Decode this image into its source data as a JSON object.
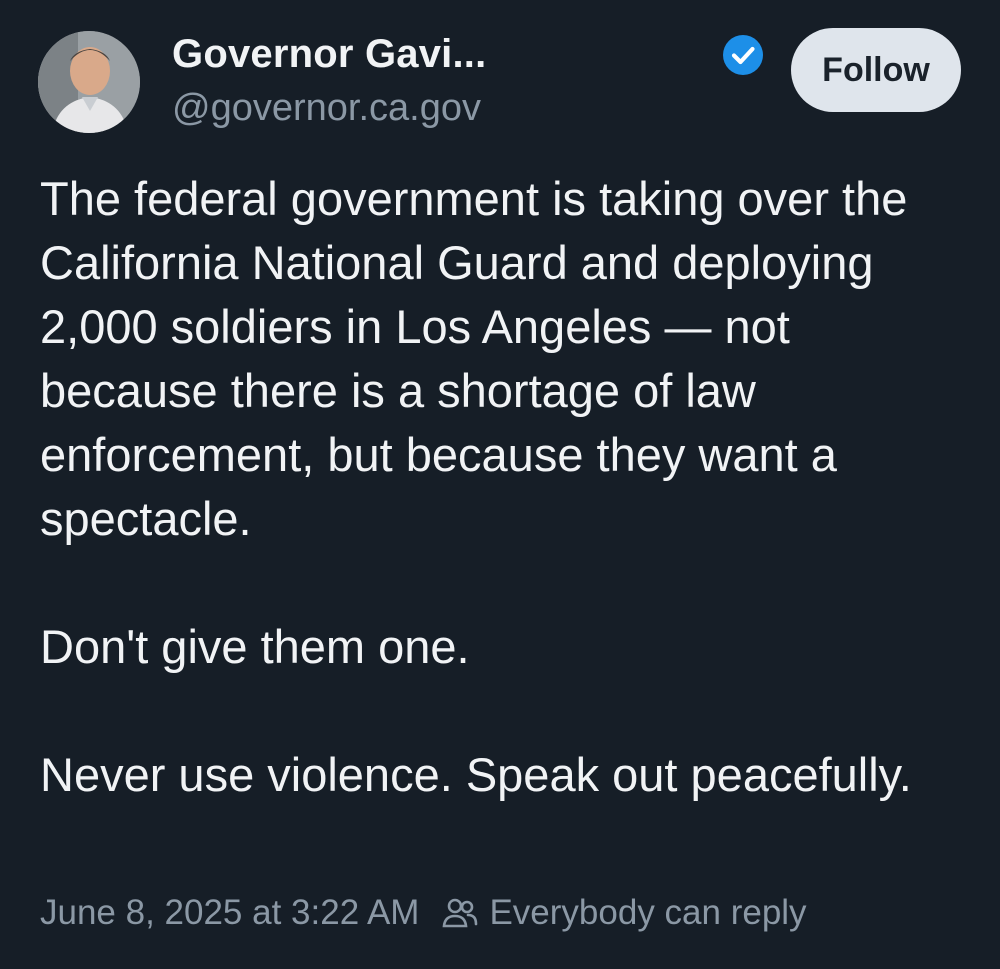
{
  "author": {
    "name": "Governor Gavi...",
    "handle": "@governor.ca.gov",
    "verified_icon": "verified-check-icon",
    "verified_color": "#1d8fe8"
  },
  "follow_button": {
    "label": "Follow"
  },
  "post": {
    "paragraphs": [
      "The federal government is taking over the California National Guard and deploying 2,000 soldiers in Los Angeles — not because there is a shortage of law enforcement, but because they want a spectacle.",
      "Don't give them one.",
      "Never use violence. Speak out peacefully."
    ]
  },
  "meta": {
    "timestamp": "June 8, 2025 at 3:22 AM",
    "reply_icon": "people-icon",
    "reply_setting": "Everybody can reply"
  },
  "colors": {
    "background": "#161e27",
    "text": "#f1f3f5",
    "muted": "#8b98a5",
    "button_bg": "#dfe5ec"
  }
}
